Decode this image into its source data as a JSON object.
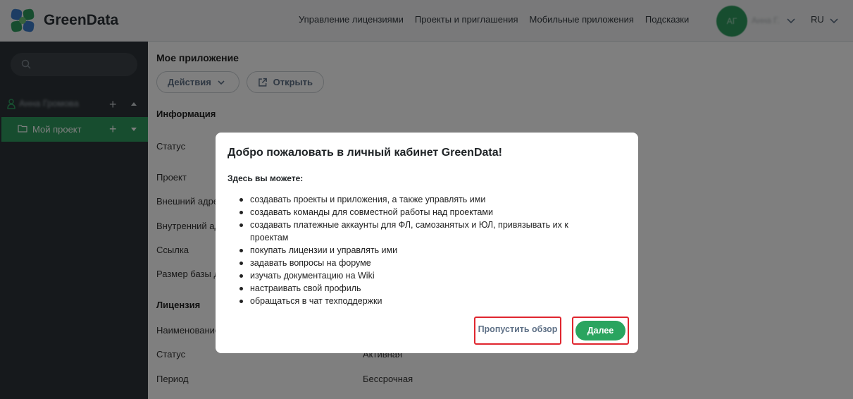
{
  "header": {
    "brand": "GreenData",
    "nav": [
      "Управление лицензиями",
      "Проекты и приглашения",
      "Мобильные приложения",
      "Подсказки"
    ],
    "username": "Анна Г.",
    "lang": "RU"
  },
  "sidebar": {
    "user_label": "Анна Громова",
    "project_label": "Мой проект"
  },
  "main": {
    "app_title": "Мое приложение",
    "actions_label": "Действия",
    "open_label": "Открыть",
    "info_title": "Информация",
    "info_rows": [
      "Статус",
      "Проект",
      "Внешний адрес",
      "Внутренний адрес",
      "Ссылка",
      "Размер базы данных"
    ],
    "license_title": "Лицензия",
    "license_rows": [
      {
        "label": "Наименование",
        "value": ""
      },
      {
        "label": "Статус",
        "value": "Активная"
      },
      {
        "label": "Период",
        "value": "Бессрочная"
      }
    ]
  },
  "modal": {
    "title": "Добро пожаловать в личный кабинет GreenData!",
    "subtitle": "Здесь вы можете:",
    "items": [
      "создавать проекты и приложения, а также управлять ими",
      "создавать команды для совместной работы над проектами",
      "создавать платежные аккаунты для ФЛ, самозанятых и ЮЛ, привязывать их к проектам",
      "покупать лицензии и управлять ими",
      "задавать вопросы на форуме",
      "изучать документацию на Wiki",
      "настраивать свой профиль",
      "обращаться в чат техподдержки"
    ],
    "skip_label": "Пропустить обзор",
    "next_label": "Далее"
  },
  "colors": {
    "brand_green": "#2e9b5f",
    "sidebar_bg": "#2d3338",
    "highlight_red": "#e0262f",
    "muted_blue": "#5f7187"
  }
}
